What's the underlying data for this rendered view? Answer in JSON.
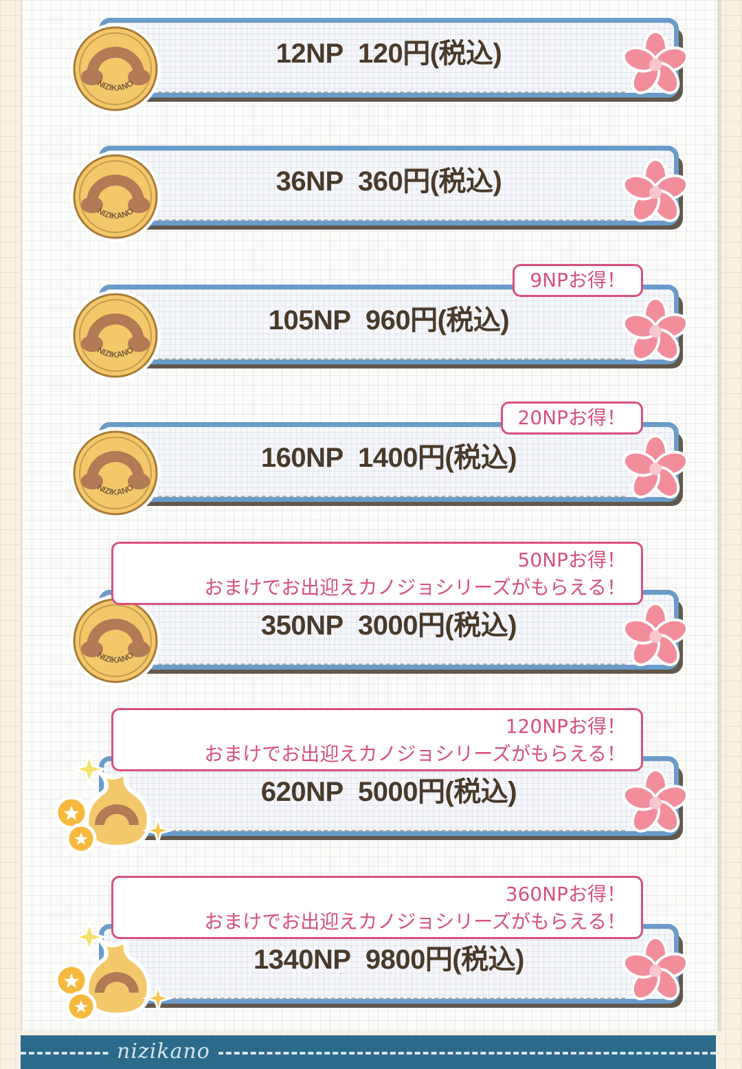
{
  "packs": [
    {
      "np": "12NP",
      "price": "120円(税込)",
      "icon": "nizikano-coin-icon",
      "badge": null
    },
    {
      "np": "36NP",
      "price": "360円(税込)",
      "icon": "nizikano-coin-icon",
      "badge": null
    },
    {
      "np": "105NP",
      "price": "960円(税込)",
      "icon": "nizikano-coin-icon",
      "badge": {
        "line1": "9NPお得！",
        "line2": null
      }
    },
    {
      "np": "160NP",
      "price": "1400円(税込)",
      "icon": "nizikano-coin-icon",
      "badge": {
        "line1": "20NPお得！",
        "line2": null
      }
    },
    {
      "np": "350NP",
      "price": "3000円(税込)",
      "icon": "nizikano-coin-icon",
      "badge": {
        "line1": "50NPお得！",
        "line2": "おまけでお出迎えカノジョシリーズがもらえる！"
      }
    },
    {
      "np": "620NP",
      "price": "5000円(税込)",
      "icon": "coin-bag-icon",
      "badge": {
        "line1": "120NPお得！",
        "line2": "おまけでお出迎えカノジョシリーズがもらえる！"
      }
    },
    {
      "np": "1340NP",
      "price": "9800円(税込)",
      "icon": "coin-bag-icon",
      "badge": {
        "line1": "360NPお得！",
        "line2": "おまけでお出迎えカノジョシリーズがもらえる！"
      }
    }
  ],
  "coin_text": "NIZIKANO",
  "footer_brand": "nizikano",
  "colors": {
    "card_border": "#6a9bc9",
    "badge_pink": "#d64f7f",
    "text_brown": "#4a3a2a",
    "coin_gold": "#f2c86a",
    "flower_pink": "#f28d9c",
    "footer_blue": "#2c6a8b"
  }
}
